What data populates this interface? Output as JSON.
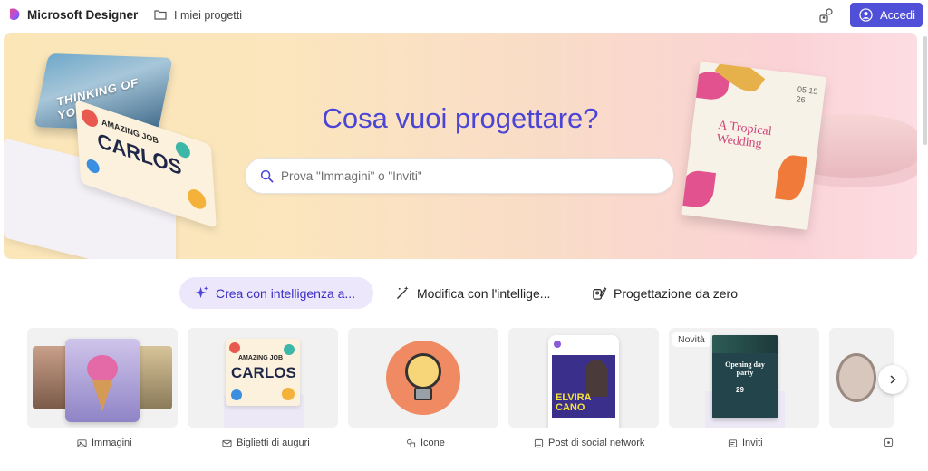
{
  "header": {
    "app_title": "Microsoft Designer",
    "projects_label": "I miei progetti",
    "signin_label": "Accedi"
  },
  "hero": {
    "title": "Cosa vuoi progettare?",
    "search_placeholder": "Prova \"Immagini\" o \"Inviti\"",
    "card_thinking_text": "THINKING OF YOU",
    "card_carlos_small": "AMAZING JOB",
    "card_carlos_big": "CARLOS",
    "wedding_title": "A Tropical Wedding",
    "wedding_date": "05 15 26"
  },
  "modes": [
    {
      "label": "Crea con intelligenza a...",
      "icon": "sparkle-icon",
      "active": true
    },
    {
      "label": "Modifica con l'intellige...",
      "icon": "magic-wand-icon",
      "active": false
    },
    {
      "label": "Progettazione da zero",
      "icon": "design-icon",
      "active": false
    }
  ],
  "categories": [
    {
      "label": "Immagini",
      "icon": "image-icon"
    },
    {
      "label": "Biglietti di auguri",
      "icon": "mail-icon"
    },
    {
      "label": "Icone",
      "icon": "shapes-icon"
    },
    {
      "label": "Post di social network",
      "icon": "social-post-icon"
    },
    {
      "label": "Inviti",
      "icon": "invitation-icon"
    }
  ],
  "category_previews": {
    "carlos_small": "AMAZING JOB",
    "carlos_big": "CARLOS",
    "elvira_name": "ELVIRA CANO",
    "invite_title": "Opening day party",
    "invite_day": "29"
  },
  "badge_new": "Novità",
  "colors": {
    "accent": "#4f4fd8",
    "hero_title": "#4a45d6",
    "active_tab_bg": "#ece7fb"
  }
}
